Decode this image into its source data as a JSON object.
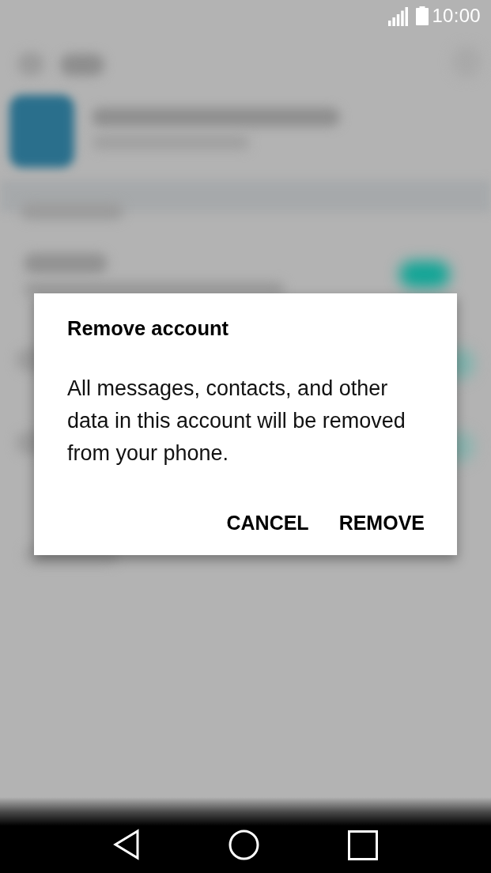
{
  "status_bar": {
    "time": "10:00"
  },
  "dialog": {
    "title": "Remove account",
    "message": "All messages, contacts, and other data in this account will be removed from your phone.",
    "buttons": [
      "CANCEL",
      "REMOVE"
    ]
  }
}
